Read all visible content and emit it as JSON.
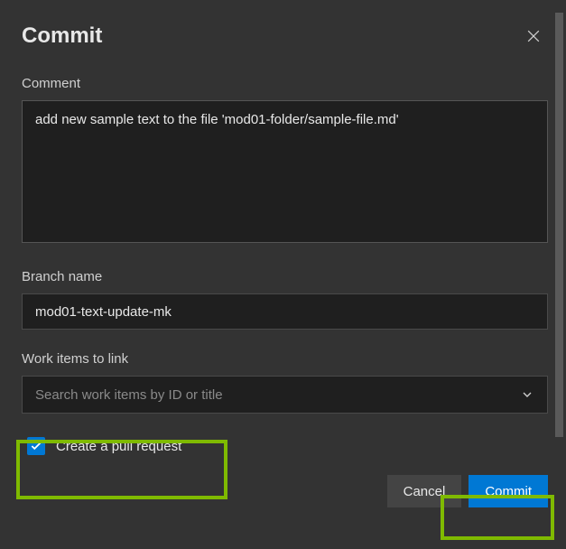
{
  "dialog": {
    "title": "Commit"
  },
  "comment": {
    "label": "Comment",
    "value": "add new sample text to the file 'mod01-folder/sample-file.md'"
  },
  "branch": {
    "label": "Branch name",
    "value": "mod01-text-update-mk"
  },
  "workItems": {
    "label": "Work items to link",
    "placeholder": "Search work items by ID or title"
  },
  "pullRequest": {
    "label": "Create a pull request",
    "checked": true
  },
  "actions": {
    "cancel": "Cancel",
    "commit": "Commit"
  }
}
